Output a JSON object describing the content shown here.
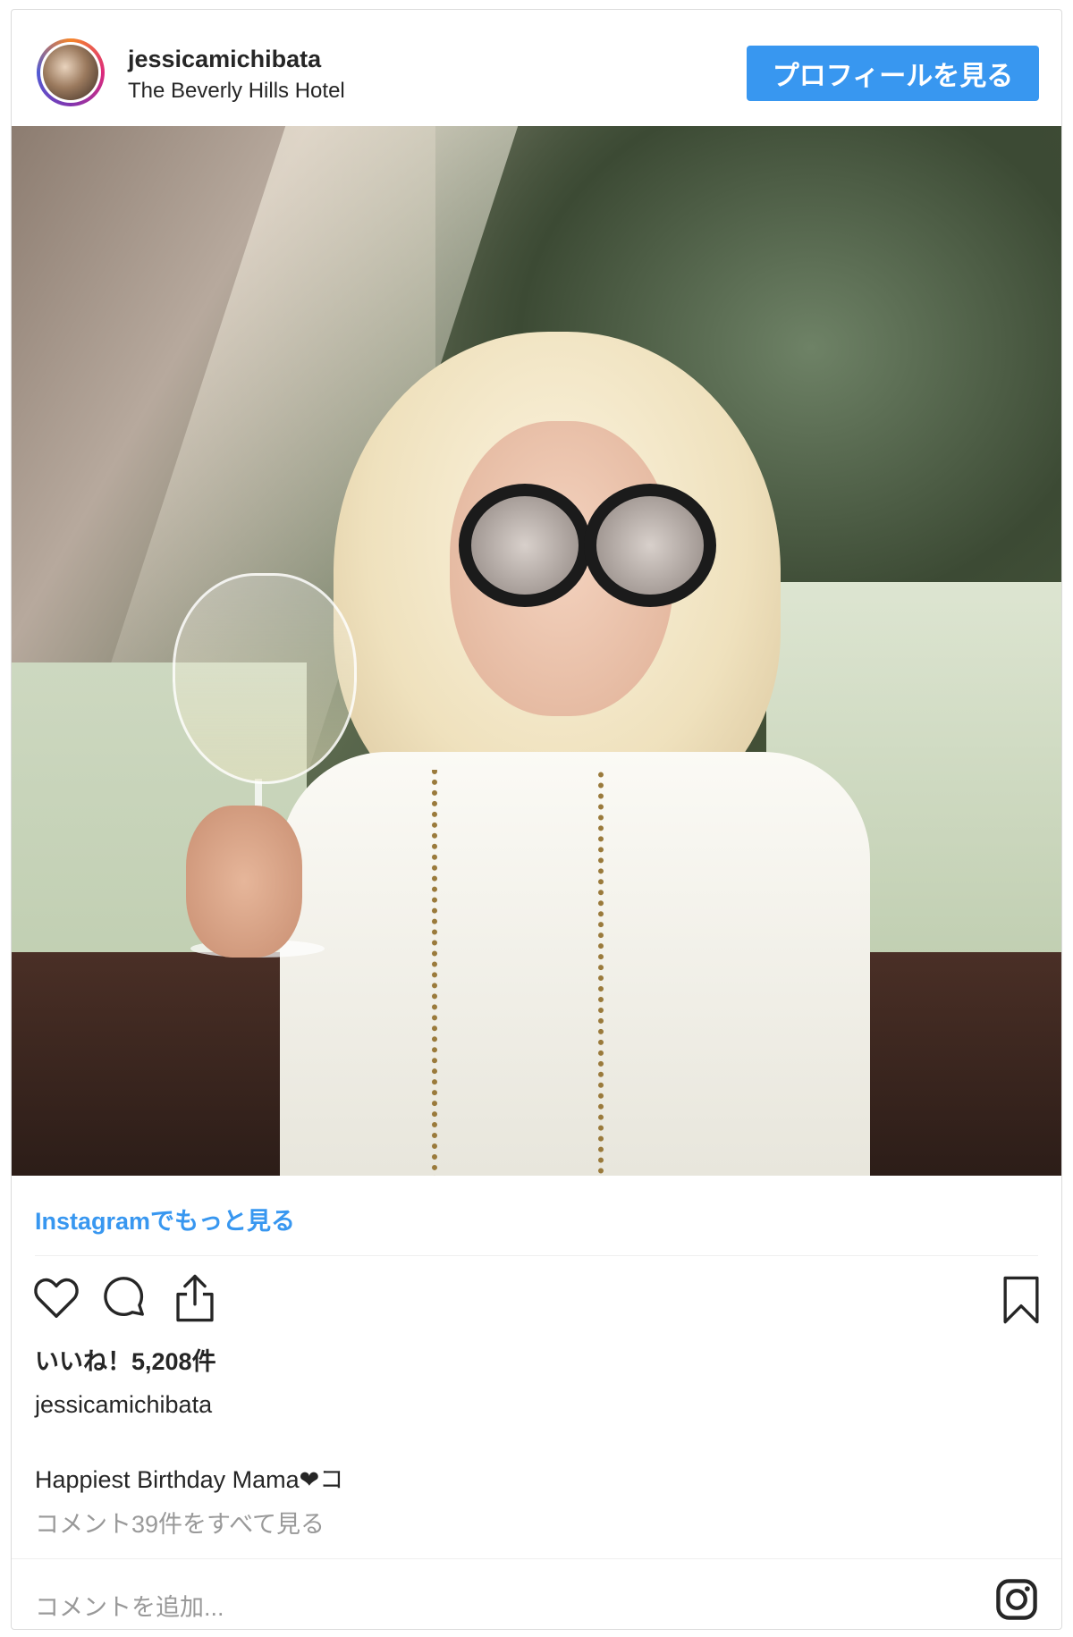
{
  "header": {
    "username": "jessicamichibata",
    "location": "The Beverly Hills Hotel",
    "profile_button": "プロフィールを見る"
  },
  "post": {
    "more_link": "Instagramでもっと見る",
    "likes": "いいね！5,208件",
    "poster": "jessicamichibata",
    "caption": "Happiest Birthday Mama❤コ",
    "view_comments": "コメント39件をすべて見る",
    "add_comment_placeholder": "コメントを追加..."
  },
  "icons": {
    "like": "heart-icon",
    "comment": "comment-icon",
    "share": "share-icon",
    "save": "bookmark-icon",
    "instagram": "instagram-icon"
  },
  "colors": {
    "accent": "#3897f0",
    "text": "#262626",
    "muted": "#999999"
  }
}
